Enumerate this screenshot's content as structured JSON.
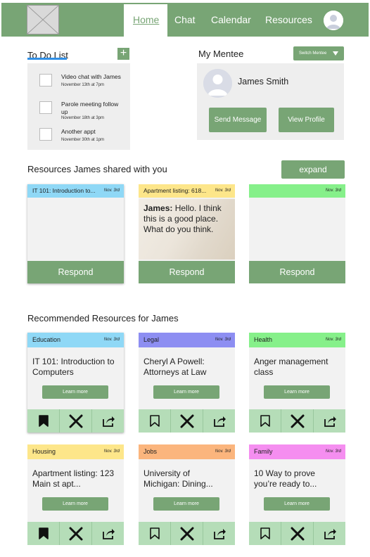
{
  "nav": {
    "items": [
      "Home",
      "Chat",
      "Calendar",
      "Resources"
    ]
  },
  "todo": {
    "title": "To Do List",
    "add_label": "+",
    "items": [
      {
        "title": "Video chat with James",
        "date": "November 13th at 7pm"
      },
      {
        "title": "Parole meeting follow up",
        "date": "November 18th at 3pm"
      },
      {
        "title": "Another appt",
        "date": "November 30th at 1pm"
      }
    ]
  },
  "mentee": {
    "title": "My Mentee",
    "switch_label": "Switch Mentee",
    "name": "James Smith",
    "send_message": "Send Message",
    "view_profile": "View Profile"
  },
  "shared": {
    "title": "Resources James shared with you",
    "expand_label": "expand",
    "respond_label": "Respond",
    "cards": [
      {
        "tag": "IT 101: Introduction to...",
        "date": "Nov. 3rd",
        "color": "#8fd8f6",
        "sender": "",
        "message": ""
      },
      {
        "tag": "Apartment listing: 618...",
        "date": "Nov. 3rd",
        "color": "#fde68a",
        "sender": "James:",
        "message": " Hello. I think this is a good place. What do you think."
      },
      {
        "tag": "",
        "date": "Nov. 3rd",
        "color": "#86f08a",
        "sender": "",
        "message": ""
      }
    ]
  },
  "recommended": {
    "title": "Recommended Resources for James",
    "learn_more": "Learn more",
    "cards": [
      {
        "category": "Education",
        "date": "Nov. 3rd",
        "color": "#8fd8f6",
        "title": "IT 101: Introduction to Computers",
        "bookmarked": true
      },
      {
        "category": "Legal",
        "date": "Nov. 3rd",
        "color": "#8d8ef2",
        "title": "Cheryl A Powell: Attorneys at Law",
        "bookmarked": false
      },
      {
        "category": "Health",
        "date": "Nov. 3rd",
        "color": "#86f08a",
        "title": "Anger management class",
        "bookmarked": false
      },
      {
        "category": "Housing",
        "date": "Nov. 3rd",
        "color": "#fde68a",
        "title": "Apartment listing: 123 Main st apt...",
        "bookmarked": true
      },
      {
        "category": "Jobs",
        "date": "Nov. 3rd",
        "color": "#fbb57d",
        "title": "University of Michigan: Dining...",
        "bookmarked": false
      },
      {
        "category": "Family",
        "date": "Nov. 3rd",
        "color": "#f58ef0",
        "title": "10 Way to prove you’re ready to...",
        "bookmarked": false
      }
    ]
  },
  "colors": {
    "accent": "#78a575",
    "action_bg": "#b5ddb8",
    "panel_bg": "#eeeeee",
    "underline": "#2f8fe6"
  },
  "icons": [
    "logo-placeholder-icon",
    "user-avatar-icon",
    "bookmark-icon",
    "close-icon",
    "share-icon"
  ]
}
